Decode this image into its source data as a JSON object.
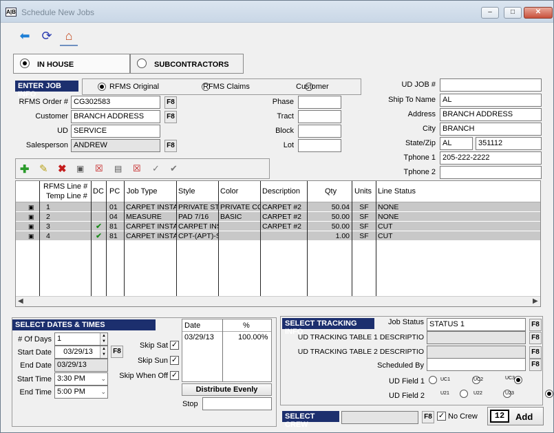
{
  "window": {
    "title": "Schedule New Jobs",
    "icon_text": "A|B"
  },
  "tabs": {
    "in_house": "IN HOUSE",
    "subcontractors": "SUBCONTRACTORS"
  },
  "job_info": {
    "header": "ENTER JOB INFO",
    "source_options": [
      "RFMS Original",
      "RFMS Claims",
      "Customer"
    ],
    "rfms_order_label": "RFMS Order #",
    "rfms_order_value": "CG302583",
    "customer_label": "Customer",
    "customer_value": "BRANCH ADDRESS",
    "ud_label": "UD",
    "ud_value": "SERVICE",
    "salesperson_label": "Salesperson",
    "salesperson_value": "ANDREW",
    "phase_label": "Phase",
    "tract_label": "Tract",
    "block_label": "Block",
    "lot_label": "Lot",
    "f8": "F8"
  },
  "ship": {
    "ud_job_label": "UD JOB #",
    "ud_job_value": "",
    "ship_to_label": "Ship To Name",
    "ship_to_value": "AL",
    "address_label": "Address",
    "address_value": "BRANCH ADDRESS",
    "city_label": "City",
    "city_value": "BRANCH",
    "state_zip_label": "State/Zip",
    "state_value": "AL",
    "zip_value": "351112",
    "tphone1_label": "Tphone 1",
    "tphone1_value": "205-222-2222",
    "tphone2_label": "Tphone 2",
    "tphone2_value": ""
  },
  "grid": {
    "headers": {
      "line": "RFMS Line #",
      "temp": "Temp Line #",
      "dc": "DC",
      "pc": "PC",
      "job_type": "Job Type",
      "style": "Style",
      "color": "Color",
      "description": "Description",
      "qty": "Qty",
      "units": "Units",
      "status": "Line Status"
    },
    "rows": [
      {
        "line": "1",
        "dc": "",
        "pc": "01",
        "job_type": "CARPET INSTA",
        "style": "PRIVATE ST",
        "color": "PRIVATE CO",
        "description": "CARPET #2",
        "qty": "50.04",
        "units": "SF",
        "status": "NONE"
      },
      {
        "line": "2",
        "dc": "",
        "pc": "04",
        "job_type": "MEASURE",
        "style": "PAD 7/16",
        "color": "BASIC",
        "description": "CARPET #2",
        "qty": "50.00",
        "units": "SF",
        "status": "NONE"
      },
      {
        "line": "3",
        "dc": "✔",
        "pc": "81",
        "job_type": "CARPET INSTA",
        "style": "CARPET INS",
        "color": "",
        "description": "CARPET #2",
        "qty": "50.00",
        "units": "SF",
        "status": "CUT"
      },
      {
        "line": "4",
        "dc": "✔",
        "pc": "81",
        "job_type": "CARPET INSTA",
        "style": "CPT-(APT)-S",
        "color": "",
        "description": "",
        "qty": "1.00",
        "units": "SF",
        "status": "CUT"
      }
    ]
  },
  "dates": {
    "header": "SELECT DATES & TIMES",
    "num_days_label": "# Of Days",
    "num_days_value": "1",
    "start_date_label": "Start Date",
    "start_date_value": "03/29/13",
    "end_date_label": "End Date",
    "end_date_value": "03/29/13",
    "start_time_label": "Start Time",
    "start_time_value": "3:30 PM",
    "end_time_label": "End Time",
    "end_time_value": "5:00 PM",
    "skip_sat": "Skip Sat",
    "skip_sun": "Skip Sun",
    "skip_off": "Skip When Off",
    "table_date_header": "Date",
    "table_pct_header": "%",
    "table_rows": [
      {
        "date": "03/29/13",
        "pct": "100.00%"
      }
    ],
    "distribute": "Distribute Evenly",
    "stop_label": "Stop",
    "stop_value": ""
  },
  "tracking": {
    "header": "SELECT TRACKING INFO",
    "job_status_label": "Job Status",
    "job_status_value": "STATUS 1",
    "ud1_label": "UD TRACKING TABLE 1 DESCRIPTIO",
    "ud2_label": "UD TRACKING TABLE 2 DESCRIPTIO",
    "scheduled_by_label": "Scheduled By",
    "ud_field1_label": "UD Field 1",
    "ud_field1_options": [
      "UC1",
      "UC2",
      "UC3"
    ],
    "ud_field1_selected": "UC3",
    "ud_field2_label": "UD Field 2",
    "ud_field2_options": [
      "U21",
      "U22",
      "U23"
    ],
    "ud_field2_selected": "U23"
  },
  "crew": {
    "header": "SELECT CREW",
    "no_crew": "No Crew",
    "add": "Add",
    "add_icon_text": "12"
  }
}
